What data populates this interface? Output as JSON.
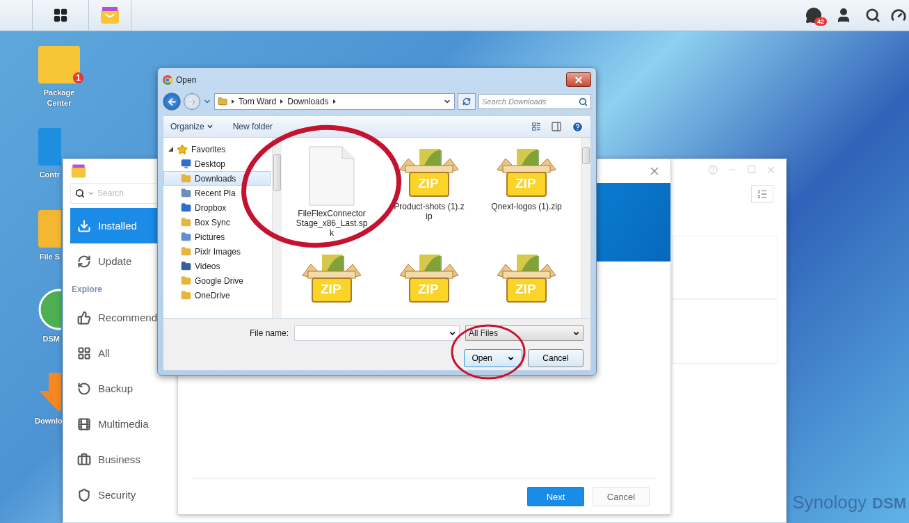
{
  "taskbar": {
    "notification_count": "42"
  },
  "desktop_icons": [
    {
      "label": "Package Center",
      "badge": "1"
    },
    {
      "label": "Contr"
    },
    {
      "label": "File S"
    },
    {
      "label": "DSM"
    },
    {
      "label": "Downlo"
    }
  ],
  "package_center": {
    "search": {
      "placeholder": "Search"
    },
    "nav": [
      {
        "kind": "item",
        "label": "Installed",
        "selected": true
      },
      {
        "kind": "item",
        "label": "Update",
        "selected": false
      },
      {
        "kind": "header",
        "label": "Explore"
      },
      {
        "kind": "item",
        "label": "Recommend",
        "selected": false
      },
      {
        "kind": "item",
        "label": "All",
        "selected": false
      },
      {
        "kind": "item",
        "label": "Backup",
        "selected": false
      },
      {
        "kind": "item",
        "label": "Multimedia",
        "selected": false
      },
      {
        "kind": "item",
        "label": "Business",
        "selected": false
      },
      {
        "kind": "item",
        "label": "Security",
        "selected": false
      }
    ]
  },
  "wizard": {
    "buttons": [
      {
        "label": "Next",
        "primary": true
      },
      {
        "label": "Cancel",
        "primary": false
      }
    ]
  },
  "open_dialog": {
    "title": "Open",
    "path": [
      "Tom Ward",
      "Downloads"
    ],
    "search": {
      "placeholder": "Search Downloads"
    },
    "toolbar": [
      "Organize",
      "New folder"
    ],
    "tree": [
      {
        "label": "Favorites",
        "expanded": true,
        "selected": false,
        "children": [
          {
            "label": "Desktop",
            "selected": false
          },
          {
            "label": "Downloads",
            "selected": true
          },
          {
            "label": "Recent Pla",
            "selected": false
          },
          {
            "label": "Dropbox",
            "selected": false
          },
          {
            "label": "Box Sync",
            "selected": false
          },
          {
            "label": "Pictures",
            "selected": false
          },
          {
            "label": "Pixlr Images",
            "selected": false
          },
          {
            "label": "Videos",
            "selected": false
          },
          {
            "label": "Google Drive",
            "selected": false
          },
          {
            "label": "OneDrive",
            "selected": false
          }
        ]
      }
    ],
    "files": [
      {
        "kind": "document",
        "name": "FileFlexConnectorStage_x86_Last.spk"
      },
      {
        "kind": "zip",
        "name": "Product-shots (1).zip",
        "label": "ZIP"
      },
      {
        "kind": "zip",
        "name": "Qnext-logos (1).zip",
        "label": "ZIP"
      },
      {
        "kind": "zip",
        "label": "ZIP"
      },
      {
        "kind": "zip",
        "label": "ZIP"
      },
      {
        "kind": "zip",
        "label": "ZIP"
      }
    ],
    "file_name": {
      "label": "File name:"
    },
    "file_type": "All Files",
    "buttons": [
      "Open",
      "Cancel"
    ]
  },
  "branding": {
    "logo": "Synology",
    "product": "DSM"
  }
}
